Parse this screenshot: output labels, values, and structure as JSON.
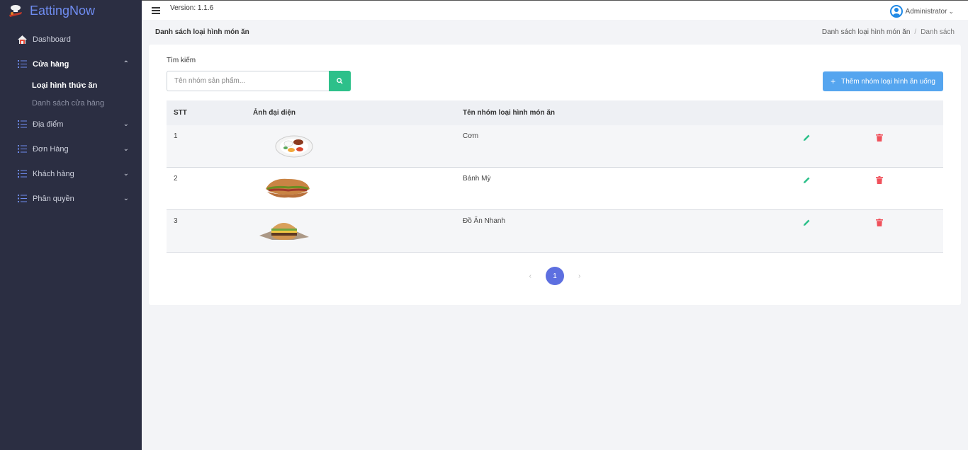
{
  "brand": {
    "name": "EattingNow"
  },
  "topbar": {
    "version": "Version: 1.1.6",
    "user": "Administrator"
  },
  "sidebar": {
    "items": [
      {
        "label": "Dashboard",
        "icon": "house-icon"
      },
      {
        "label": "Cửa hàng",
        "icon": "list-icon",
        "expanded": true
      },
      {
        "label": "Địa điểm",
        "icon": "list-icon"
      },
      {
        "label": "Đơn Hàng",
        "icon": "list-icon"
      },
      {
        "label": "Khách hàng",
        "icon": "list-icon"
      },
      {
        "label": "Phân quyền",
        "icon": "list-icon"
      }
    ],
    "submenu": [
      {
        "label": "Loại hình thức ăn",
        "active": true
      },
      {
        "label": "Danh sách cửa hàng",
        "active": false
      }
    ]
  },
  "header": {
    "title": "Danh sách loại hình món ăn",
    "breadcrumb": [
      "Danh sách loại hình món ăn",
      "Danh sách"
    ]
  },
  "search": {
    "label": "Tìm kiếm",
    "placeholder": "Tên nhóm sản phẩm...",
    "value": ""
  },
  "add_button": {
    "label": "Thêm nhóm loại hình ăn uống"
  },
  "table": {
    "columns": [
      "STT",
      "Ảnh đại diện",
      "Tên nhóm loại hình món ăn"
    ],
    "rows": [
      {
        "stt": "1",
        "image": "com-dish",
        "name": "Cơm"
      },
      {
        "stt": "2",
        "image": "banh-my",
        "name": "Bánh Mỳ"
      },
      {
        "stt": "3",
        "image": "burger",
        "name": "Đồ Ăn Nhanh"
      }
    ]
  },
  "pagination": {
    "current": "1",
    "prev": "‹",
    "next": "›"
  },
  "colors": {
    "sidebar_bg": "#2b2e42",
    "brand": "#6f8cf0",
    "search_button": "#2dc08a",
    "add_button": "#55a5ef",
    "edit_icon": "#2dc08a",
    "delete_icon": "#f0515b",
    "page_active": "#5d6fe0"
  }
}
